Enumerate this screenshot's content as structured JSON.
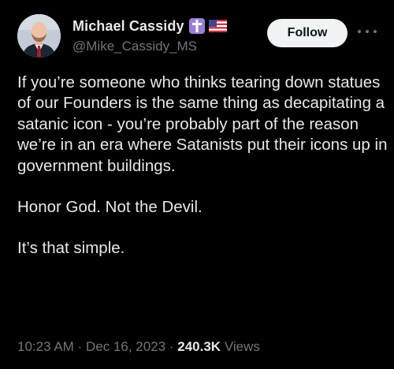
{
  "author": {
    "display_name": "Michael Cassidy",
    "handle": "@Mike_Cassidy_MS",
    "badges": [
      "latin-cross-icon",
      "us-flag-icon"
    ]
  },
  "actions": {
    "follow_label": "Follow",
    "more_icon": "more-horizontal-icon"
  },
  "tweet": {
    "paragraphs": [
      "If you’re someone who thinks tearing down statues of our Founders is the same thing as decapitating a satanic icon - you’re probably part of the reason we’re in an era where Satanists put their icons up in government buildings.",
      "Honor God. Not the Devil.",
      "It’s that simple."
    ]
  },
  "meta": {
    "time": "10:23 AM",
    "separator": "·",
    "date": "Dec 16, 2023",
    "views_count": "240.3K",
    "views_label": "Views"
  },
  "colors": {
    "background": "#000000",
    "text": "#e7e9ea",
    "secondary": "#71767b",
    "follow_bg": "#eff3f4",
    "badge_purple": "#9b7fd6"
  }
}
